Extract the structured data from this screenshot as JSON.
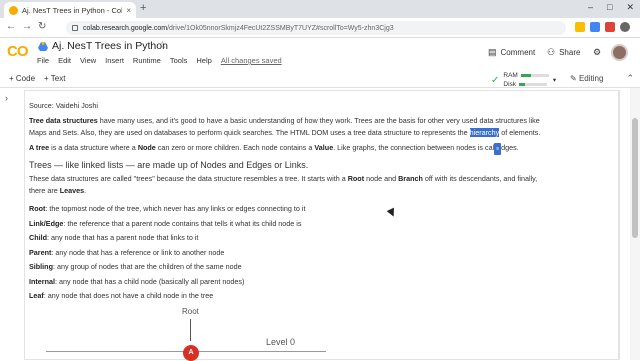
{
  "browser": {
    "tab_title": "Aj. NesT Trees in Python - Colab",
    "tab_close": "×",
    "new_tab": "+",
    "url_host": "colab.research.google.com",
    "url_path": "/drive/1Ok05nnorSkmjz4FecUt2ZSSMByT7UYZ#scrollTo=Wy5-zhn3Cjg3",
    "url_full": "colab.research.google.com/drive/1Ok05nnorSkmjz4FecUt2ZSSMByT7UYZ#scrollTo=Wy5-zhn3Cjg3"
  },
  "colab": {
    "logo": "CO",
    "notebook_title": "Aj. NesT Trees in Python",
    "star": "☆",
    "menu": [
      "File",
      "Edit",
      "View",
      "Insert",
      "Runtime",
      "Tools",
      "Help"
    ],
    "saved_status": "All changes saved",
    "comment_label": "Comment",
    "share_label": "Share"
  },
  "toolbar": {
    "add_code": "+ Code",
    "add_text": "+ Text",
    "ram_label": "RAM",
    "disk_label": "Disk",
    "editing_label": "Editing"
  },
  "content": {
    "source": "Source: Vaidehi Joshi",
    "para1_bold": "Tree data structures",
    "para1_a": " have many uses, and it's good to have a basic understanding of how they work. Trees are the basis for other very used data structures like Maps and Sets. Also, they are used on databases to perform quick searches. The HTML DOM uses a tree data structure to represents the ",
    "para1_highlight": "hierarchy",
    "para1_b": " of elements.",
    "para2_bold1": "A tree",
    "para2_a": " is a data structure where a ",
    "para2_bold2": "Node",
    "para2_b": " can zero or more children. Each node contains a ",
    "para2_bold3": "Value",
    "para2_c": ". Like graphs, the connection between nodes is cal",
    "para2_tooltip": "≡",
    "para2_d": "dges.",
    "heading": "Trees — like linked lists — are made up of Nodes and Edges or Links.",
    "para3_a": "These data structures are called \"trees\" because the data structure resembles a tree. It starts with a ",
    "para3_bold1": "Root",
    "para3_b": " node and ",
    "para3_bold2": "Branch",
    "para3_c": " off with its descendants, and finally, there are ",
    "para3_bold3": "Leaves",
    "para3_d": ".",
    "definitions": [
      {
        "term": "Root",
        "text": ": the topmost node of the tree, which never has any links or edges connecting to it"
      },
      {
        "term": "Link/Edge",
        "text": ": the reference that a parent node contains that tells it what its child node is"
      },
      {
        "term": "Child",
        "text": ": any node that has a parent node that links to it"
      },
      {
        "term": "Parent",
        "text": ": any node that has a reference or link to another node"
      },
      {
        "term": "Sibling",
        "text": ": any group of nodes that are the children of the same node"
      },
      {
        "term": "Internal",
        "text": ": any node that has a child node (basically all parent nodes)"
      },
      {
        "term": "Leaf",
        "text": ": any node that does not have a child node in the tree"
      }
    ]
  },
  "diagram": {
    "root_label": "Root",
    "level_label": "Level 0",
    "node_label": "A"
  },
  "colors": {
    "accent": "#f9ab00",
    "highlight": "#3b6fcf",
    "node": "#d93025",
    "ok": "#34a853"
  }
}
